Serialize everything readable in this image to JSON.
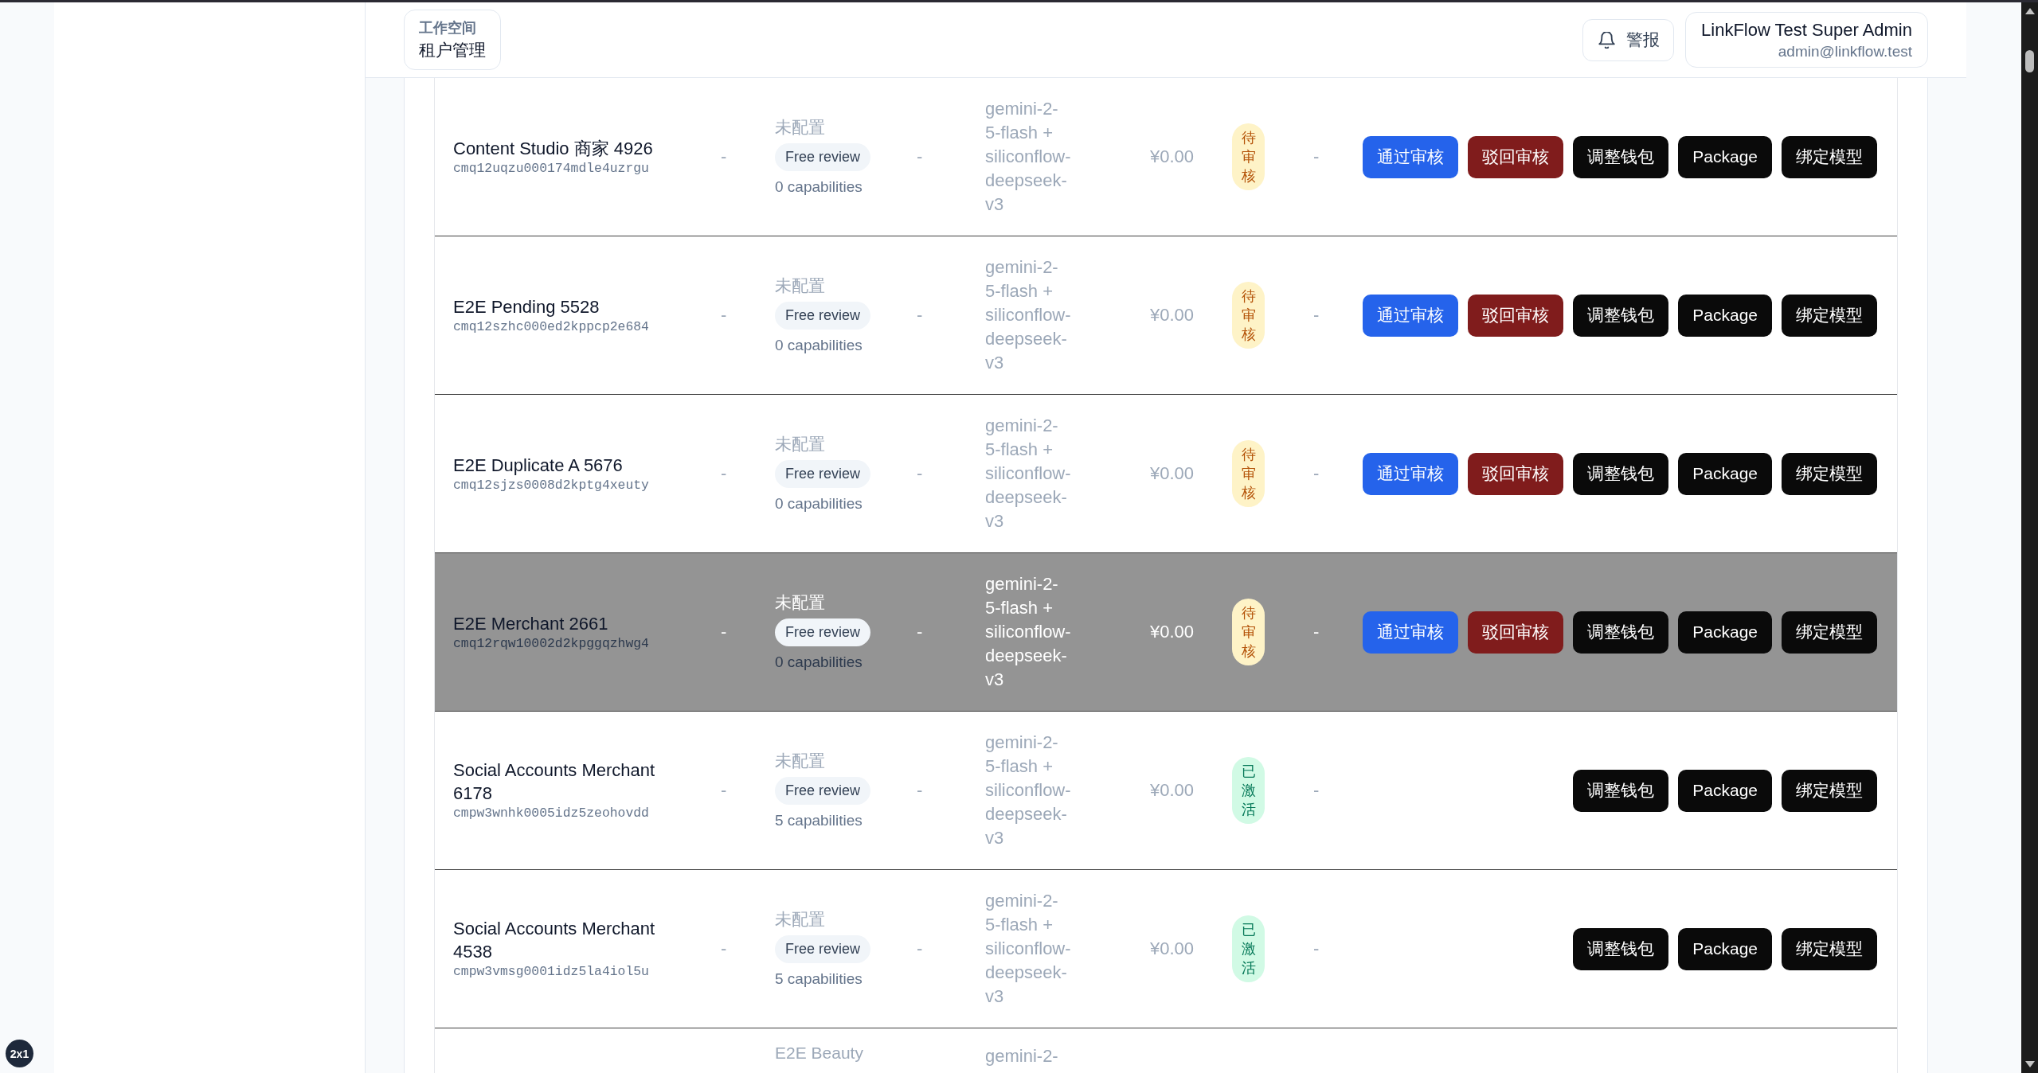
{
  "header": {
    "workspace": {
      "label": "工作空间",
      "title": "租户管理"
    },
    "alert_button": {
      "label": "警报"
    },
    "user": {
      "name": "LinkFlow Test Super Admin",
      "email": "admin@linkflow.test"
    }
  },
  "table": {
    "rows": [
      {
        "selected": false,
        "name": "Content Studio 商家 4926",
        "id": "cmq12uqzu000174mdle4uzrgu",
        "column_2": "-",
        "column_3": {
          "text": "未配置",
          "tag": "Free review",
          "note": "0 capabilities"
        },
        "column_4": "-",
        "column_5": "gemini-2-5-flash + siliconflow-deepseek-v3",
        "column_6": "¥0.00",
        "status": {
          "kind": "pending",
          "label": "待审核"
        },
        "column_8": "-",
        "actions": [
          {
            "kind": "approve",
            "label": "通过审核"
          },
          {
            "kind": "reject",
            "label": "驳回审核"
          },
          {
            "kind": "wallet",
            "label": "调整钱包"
          },
          {
            "kind": "package",
            "label": "Package"
          },
          {
            "kind": "bind-model",
            "label": "绑定模型"
          }
        ]
      },
      {
        "selected": false,
        "name": "E2E Pending 5528",
        "id": "cmq12szhc000ed2kppcp2e684",
        "column_2": "-",
        "column_3": {
          "text": "未配置",
          "tag": "Free review",
          "note": "0 capabilities"
        },
        "column_4": "-",
        "column_5": "gemini-2-5-flash + siliconflow-deepseek-v3",
        "column_6": "¥0.00",
        "status": {
          "kind": "pending",
          "label": "待审核"
        },
        "column_8": "-",
        "actions": [
          {
            "kind": "approve",
            "label": "通过审核"
          },
          {
            "kind": "reject",
            "label": "驳回审核"
          },
          {
            "kind": "wallet",
            "label": "调整钱包"
          },
          {
            "kind": "package",
            "label": "Package"
          },
          {
            "kind": "bind-model",
            "label": "绑定模型"
          }
        ]
      },
      {
        "selected": false,
        "name": "E2E Duplicate A 5676",
        "id": "cmq12sjzs0008d2kptg4xeuty",
        "column_2": "-",
        "column_3": {
          "text": "未配置",
          "tag": "Free review",
          "note": "0 capabilities"
        },
        "column_4": "-",
        "column_5": "gemini-2-5-flash + siliconflow-deepseek-v3",
        "column_6": "¥0.00",
        "status": {
          "kind": "pending",
          "label": "待审核"
        },
        "column_8": "-",
        "actions": [
          {
            "kind": "approve",
            "label": "通过审核"
          },
          {
            "kind": "reject",
            "label": "驳回审核"
          },
          {
            "kind": "wallet",
            "label": "调整钱包"
          },
          {
            "kind": "package",
            "label": "Package"
          },
          {
            "kind": "bind-model",
            "label": "绑定模型"
          }
        ]
      },
      {
        "selected": true,
        "name": "E2E Merchant 2661",
        "id": "cmq12rqw10002d2kpggqzhwg4",
        "column_2": "-",
        "column_3": {
          "text": "未配置",
          "tag": "Free review",
          "note": "0 capabilities"
        },
        "column_4": "-",
        "column_5": "gemini-2-5-flash + siliconflow-deepseek-v3",
        "column_6": "¥0.00",
        "status": {
          "kind": "pending",
          "label": "待审核"
        },
        "column_8": "-",
        "actions": [
          {
            "kind": "approve",
            "label": "通过审核"
          },
          {
            "kind": "reject",
            "label": "驳回审核"
          },
          {
            "kind": "wallet",
            "label": "调整钱包"
          },
          {
            "kind": "package",
            "label": "Package"
          },
          {
            "kind": "bind-model",
            "label": "绑定模型"
          }
        ]
      },
      {
        "selected": false,
        "name": "Social Accounts Merchant 6178",
        "id": "cmpw3wnhk0005idz5zeohovdd",
        "column_2": "-",
        "column_3": {
          "text": "未配置",
          "tag": "Free review",
          "note": "5 capabilities"
        },
        "column_4": "-",
        "column_5": "gemini-2-5-flash + siliconflow-deepseek-v3",
        "column_6": "¥0.00",
        "status": {
          "kind": "active",
          "label": "已激活"
        },
        "column_8": "-",
        "actions": [
          {
            "kind": "wallet",
            "label": "调整钱包"
          },
          {
            "kind": "package",
            "label": "Package"
          },
          {
            "kind": "bind-model",
            "label": "绑定模型"
          }
        ]
      },
      {
        "selected": false,
        "name": "Social Accounts Merchant 4538",
        "id": "cmpw3vmsg0001idz5la4iol5u",
        "column_2": "-",
        "column_3": {
          "text": "未配置",
          "tag": "Free review",
          "note": "5 capabilities"
        },
        "column_4": "-",
        "column_5": "gemini-2-5-flash + siliconflow-deepseek-v3",
        "column_6": "¥0.00",
        "status": {
          "kind": "active",
          "label": "已激活"
        },
        "column_8": "-",
        "actions": [
          {
            "kind": "wallet",
            "label": "调整钱包"
          },
          {
            "kind": "package",
            "label": "Package"
          },
          {
            "kind": "bind-model",
            "label": "绑定模型"
          }
        ]
      },
      {
        "selected": false,
        "column_3": {
          "text": "E2E Beauty"
        },
        "column_5": "gemini-2-"
      }
    ]
  },
  "dev_badge": {
    "label": "2x1"
  }
}
